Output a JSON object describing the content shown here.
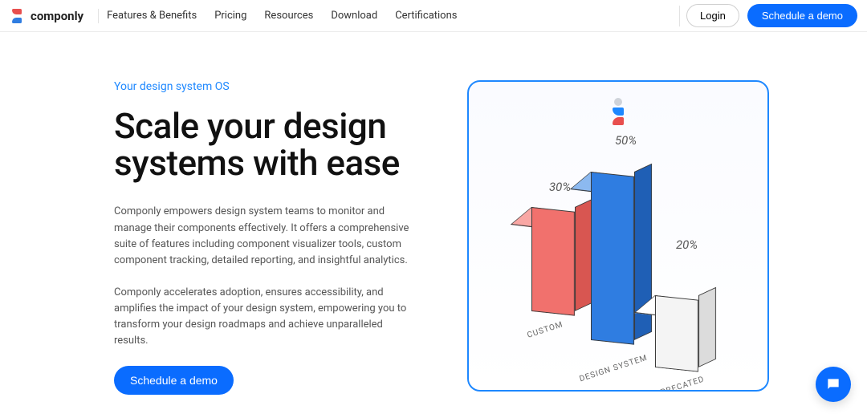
{
  "brand": {
    "name": "componly"
  },
  "nav": {
    "items": [
      "Features & Benefits",
      "Pricing",
      "Resources",
      "Download",
      "Certifications"
    ]
  },
  "header": {
    "login": "Login",
    "demo": "Schedule a demo"
  },
  "hero": {
    "eyebrow": "Your design system OS",
    "title": "Scale your design systems with ease",
    "p1": "Componly empowers design system teams to monitor and manage their components effectively. It offers a comprehensive suite of features including component visualizer tools, custom component tracking, detailed reporting, and insightful analytics.",
    "p2": "Componly accelerates adoption, ensures accessibility, and amplifies the impact of your design system, empowering you to transform your design roadmaps and achieve unparalleled results.",
    "cta": "Schedule a demo"
  },
  "chart_data": {
    "type": "bar",
    "categories": [
      "CUSTOM",
      "DESIGN SYSTEM",
      "DEPRECATED"
    ],
    "values": [
      30,
      50,
      20
    ],
    "value_labels": [
      "30%",
      "50%",
      "20%"
    ],
    "colors": [
      "#f1716d",
      "#2f7de1",
      "#f4f4f4"
    ],
    "title": "",
    "xlabel": "",
    "ylabel": "",
    "ylim": [
      0,
      100
    ]
  },
  "chat": {
    "label": "Open chat"
  }
}
